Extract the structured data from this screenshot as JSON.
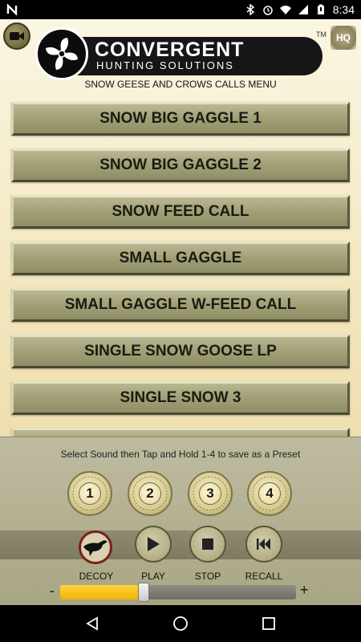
{
  "status_bar": {
    "time": "8:34",
    "icons": [
      "notification-n-icon",
      "bluetooth-icon",
      "alarm-icon",
      "wifi-icon",
      "signal-icon",
      "battery-icon"
    ]
  },
  "header": {
    "brand_line1": "CONVERGENT",
    "brand_line2": "HUNTING SOLUTIONS",
    "trademark": "TM",
    "hq_badge": "HQ",
    "menu_title": "SNOW GEESE AND CROWS CALLS MENU"
  },
  "calls": [
    {
      "label": "SNOW BIG GAGGLE 1"
    },
    {
      "label": "SNOW BIG GAGGLE 2"
    },
    {
      "label": "SNOW FEED CALL"
    },
    {
      "label": "SMALL GAGGLE"
    },
    {
      "label": "SMALL GAGGLE W-FEED CALL"
    },
    {
      "label": "SINGLE SNOW GOOSE LP"
    },
    {
      "label": "SINGLE SNOW 3"
    }
  ],
  "panel": {
    "instruction": "Select Sound then Tap and Hold 1-4 to save as a Preset",
    "presets": [
      {
        "number": "1",
        "ring_text": "BULLET HP"
      },
      {
        "number": "2",
        "ring_text": "BULLET HP"
      },
      {
        "number": "3",
        "ring_text": "BULLET HP"
      },
      {
        "number": "4",
        "ring_text": "BULLET HP"
      }
    ],
    "controls": {
      "decoy": "DECOY",
      "play": "PLAY",
      "stop": "STOP",
      "recall": "RECALL"
    },
    "volume": {
      "minus": "-",
      "plus": "+",
      "level": 0.35
    }
  },
  "colors": {
    "app_bg_top": "#fbf6e3",
    "app_bg_bottom": "#efdfae",
    "button_face": "#a09f76",
    "panel_bg": "#bebba0",
    "slider_fill": "#f2b400",
    "decoy_ring": "#7a1f1f"
  }
}
